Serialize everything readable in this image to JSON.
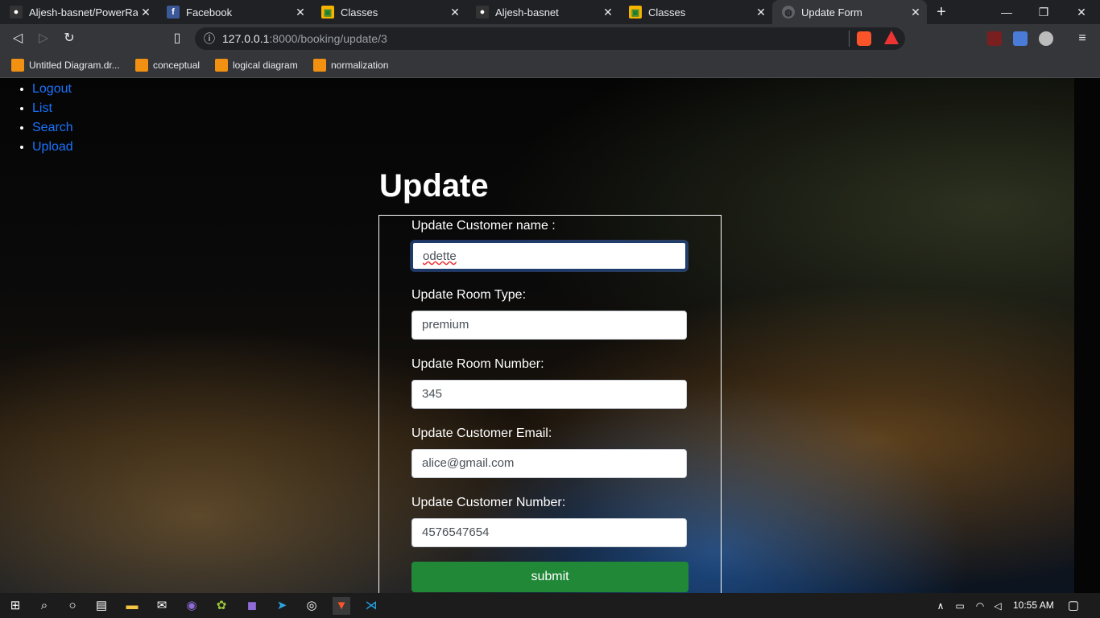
{
  "browser": {
    "tabs": [
      {
        "title": "Aljesh-basnet/PowerRang",
        "icon": "github-icon"
      },
      {
        "title": "Facebook",
        "icon": "facebook-icon"
      },
      {
        "title": "Classes",
        "icon": "classroom-icon"
      },
      {
        "title": "Aljesh-basnet",
        "icon": "github-icon"
      },
      {
        "title": "Classes",
        "icon": "classroom-icon"
      },
      {
        "title": "Update Form",
        "icon": "globe-icon"
      }
    ],
    "url_host": "127.0.0.1",
    "url_path": ":8000/booking/update/3",
    "bookmarks": [
      "Untitled Diagram.dr...",
      "conceptual",
      "logical diagram",
      "normalization"
    ]
  },
  "nav": {
    "items": [
      "Logout",
      "List",
      "Search",
      "Upload"
    ]
  },
  "page_title": "Update",
  "form": {
    "fields": [
      {
        "label": "Update Customer name :",
        "value": "odette"
      },
      {
        "label": "Update Room Type:",
        "value": "premium"
      },
      {
        "label": "Update Room Number:",
        "value": "345"
      },
      {
        "label": "Update Customer Email:",
        "value": "alice@gmail.com"
      },
      {
        "label": "Update Customer Number:",
        "value": "4576547654"
      }
    ],
    "submit_label": "submit"
  },
  "taskbar": {
    "time": "10:55 AM"
  },
  "colors": {
    "link": "#1a73ff",
    "submit": "#218838"
  }
}
